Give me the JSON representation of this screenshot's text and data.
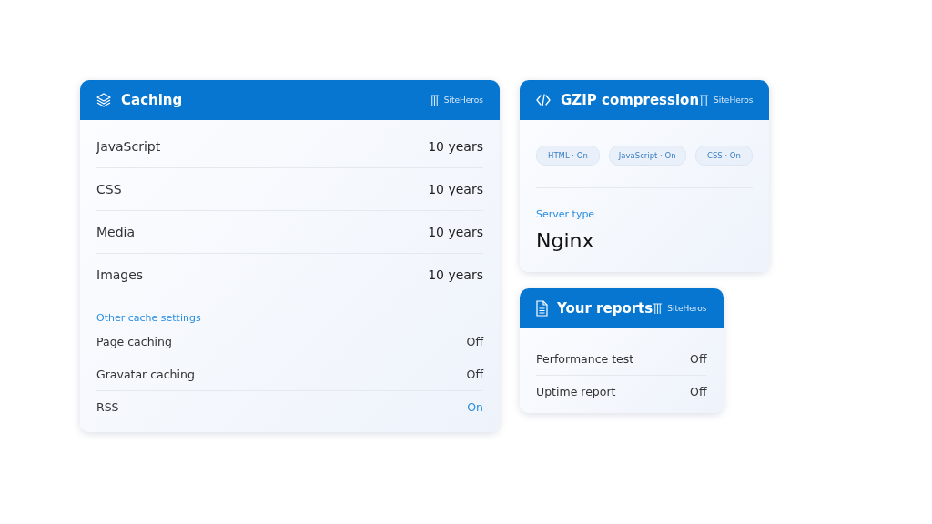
{
  "caching": {
    "title": "Caching",
    "brand": "SiteHeros",
    "rows": [
      {
        "label": "JavaScript",
        "value": "10 years"
      },
      {
        "label": "CSS",
        "value": "10 years"
      },
      {
        "label": "Media",
        "value": "10 years"
      },
      {
        "label": "Images",
        "value": "10 years"
      }
    ],
    "section_label": "Other cache settings",
    "settings": [
      {
        "label": "Page caching",
        "value": "Off",
        "on": false
      },
      {
        "label": "Gravatar caching",
        "value": "Off",
        "on": false
      },
      {
        "label": "RSS",
        "value": "On",
        "on": true
      }
    ]
  },
  "gzip": {
    "title": "GZIP compression",
    "brand": "SiteHeros",
    "chips": [
      "HTML · On",
      "JavaScript · On",
      "CSS · On"
    ],
    "server_label": "Server type",
    "server_value": "Nginx"
  },
  "reports": {
    "title": "Your reports",
    "brand": "SiteHeros",
    "rows": [
      {
        "label": "Performance test",
        "value": "Off",
        "on": false
      },
      {
        "label": "Uptime report",
        "value": "Off",
        "on": false
      }
    ]
  }
}
